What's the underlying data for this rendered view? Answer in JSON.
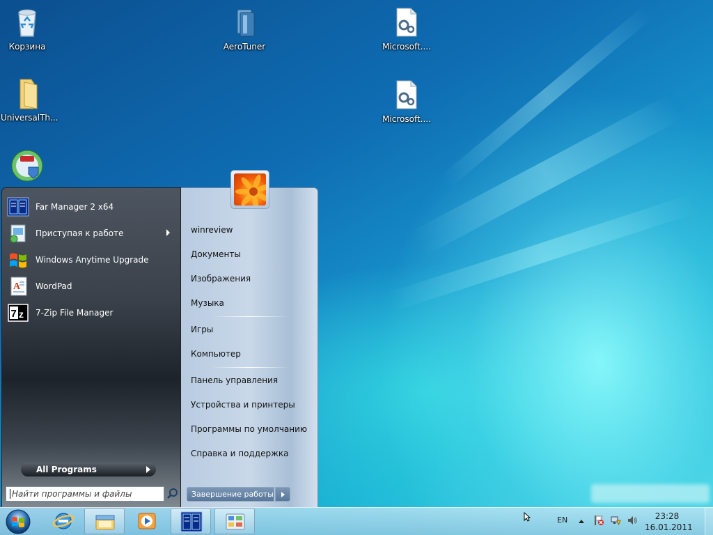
{
  "desktop": {
    "icons": [
      {
        "label": "Корзина",
        "icon": "recycle-bin-icon"
      },
      {
        "label": "AeroTuner",
        "icon": "aerotuner-icon"
      },
      {
        "label": "Microsoft....",
        "icon": "settings-file-icon"
      },
      {
        "label": "UniversalTh...",
        "icon": "folder-icon"
      },
      {
        "label": "Microsoft....",
        "icon": "settings-file-icon"
      },
      {
        "label": "",
        "icon": "nsis-installer-icon"
      }
    ]
  },
  "start_menu": {
    "programs": [
      {
        "label": "Far Manager 2 x64",
        "icon": "far-manager-icon",
        "has_submenu": false
      },
      {
        "label": "Приступая к работе",
        "icon": "getting-started-icon",
        "has_submenu": true
      },
      {
        "label": "Windows Anytime Upgrade",
        "icon": "windows-flag-icon",
        "has_submenu": false
      },
      {
        "label": "WordPad",
        "icon": "wordpad-icon",
        "has_submenu": false
      },
      {
        "label": "7-Zip File Manager",
        "icon": "7zip-icon",
        "has_submenu": false
      }
    ],
    "all_programs": "All Programs",
    "search_placeholder": "Найти программы и файлы",
    "right_items": {
      "user": "winreview",
      "documents": "Документы",
      "pictures": "Изображения",
      "music": "Музыка",
      "games": "Игры",
      "computer": "Компьютер",
      "control_panel": "Панель управления",
      "devices": "Устройства и принтеры",
      "default_programs": "Программы по умолчанию",
      "help": "Справка и поддержка"
    },
    "shutdown_label": "Завершение работы"
  },
  "taskbar": {
    "pinned": [
      {
        "icon": "internet-explorer-icon",
        "open": false
      },
      {
        "icon": "explorer-folders-icon",
        "open": true
      },
      {
        "icon": "media-player-icon",
        "open": false
      },
      {
        "icon": "far-manager-icon",
        "open": true
      },
      {
        "icon": "control-panel-icon",
        "open": true
      }
    ],
    "language": "EN",
    "time": "23:28",
    "date": "16.01.2011"
  },
  "colors": {
    "accent": "#1690c9",
    "start_left": "#2b3139",
    "start_right": "#c9d8e9"
  }
}
